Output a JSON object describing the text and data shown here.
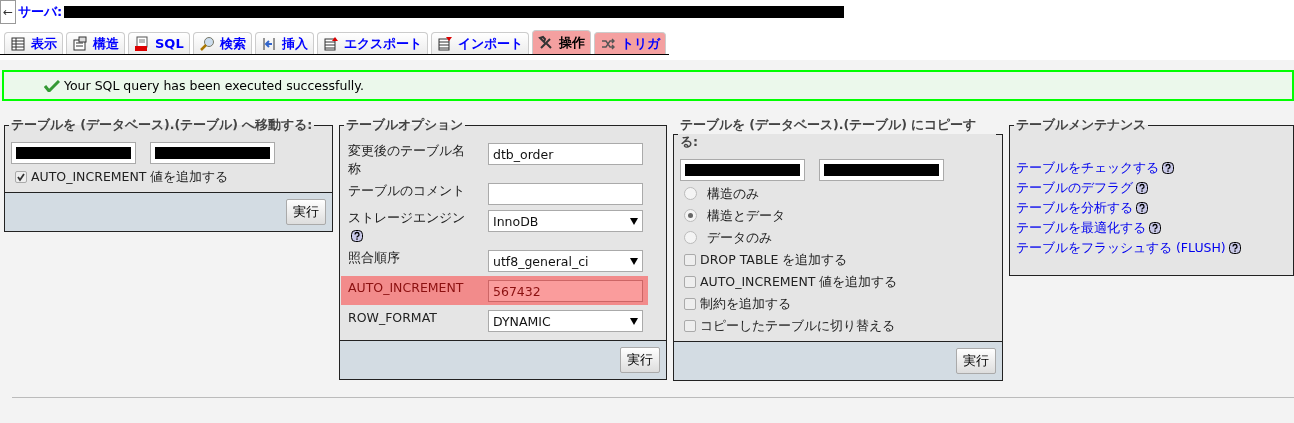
{
  "server": {
    "back": "←",
    "label": "サーバ:"
  },
  "tabs": [
    {
      "label": "表示",
      "selected": false,
      "highlighted": false
    },
    {
      "label": "構造",
      "selected": false,
      "highlighted": false
    },
    {
      "label": "SQL",
      "selected": false,
      "highlighted": false
    },
    {
      "label": "検索",
      "selected": false,
      "highlighted": false
    },
    {
      "label": "挿入",
      "selected": false,
      "highlighted": false
    },
    {
      "label": "エクスポート",
      "selected": false,
      "highlighted": false
    },
    {
      "label": "インポート",
      "selected": false,
      "highlighted": false
    },
    {
      "label": "操作",
      "selected": true,
      "highlighted": true
    },
    {
      "label": "トリガ",
      "selected": false,
      "highlighted": true
    }
  ],
  "notice": {
    "kind": "success",
    "text": "Your SQL query has been executed successfully."
  },
  "move_table": {
    "legend": "テーブルを (データベース).(テーブル) へ移動する:",
    "checkbox": {
      "label": "AUTO_INCREMENT 値を追加する",
      "checked": true
    },
    "button": "実行"
  },
  "table_options": {
    "legend": "テーブルオプション",
    "rows": [
      {
        "kind": "text",
        "label": "変更後のテーブル名称",
        "value": "dtb_order",
        "highlighted": false
      },
      {
        "kind": "text",
        "label": "テーブルのコメント",
        "highlighted": false
      },
      {
        "kind": "select",
        "label": "ストレージエンジン",
        "value": "InnoDB",
        "help": true,
        "highlighted": false
      },
      {
        "kind": "select",
        "label": "照合順序",
        "value": "utf8_general_ci",
        "highlighted": false
      },
      {
        "kind": "text",
        "label": "AUTO_INCREMENT",
        "value": "567432",
        "highlighted": true
      },
      {
        "kind": "select",
        "label": "ROW_FORMAT",
        "value": "DYNAMIC",
        "highlighted": false
      }
    ],
    "button": "実行"
  },
  "copy_table": {
    "legend": "テーブルを (データベース).(テーブル) にコピーする:",
    "options": [
      {
        "kind": "radio",
        "label": "構造のみ",
        "selected": false
      },
      {
        "kind": "radio",
        "label": "構造とデータ",
        "selected": true
      },
      {
        "kind": "radio",
        "label": "データのみ",
        "selected": false
      },
      {
        "kind": "checkbox",
        "label": "DROP TABLE を追加する",
        "checked": false
      },
      {
        "kind": "checkbox",
        "label": "AUTO_INCREMENT 値を追加する",
        "checked": false
      },
      {
        "kind": "checkbox",
        "label": "制約を追加する",
        "checked": false
      },
      {
        "kind": "checkbox",
        "label": "コピーしたテーブルに切り替える",
        "checked": false
      }
    ],
    "button": "実行"
  },
  "maintenance": {
    "legend": "テーブルメンテナンス",
    "links": [
      {
        "label": "テーブルをチェックする"
      },
      {
        "label": "テーブルのデフラグ"
      },
      {
        "label": "テーブルを分析する"
      },
      {
        "label": "テーブルを最適化する"
      },
      {
        "label": "テーブルをフラッシュする (FLUSH)"
      }
    ]
  }
}
